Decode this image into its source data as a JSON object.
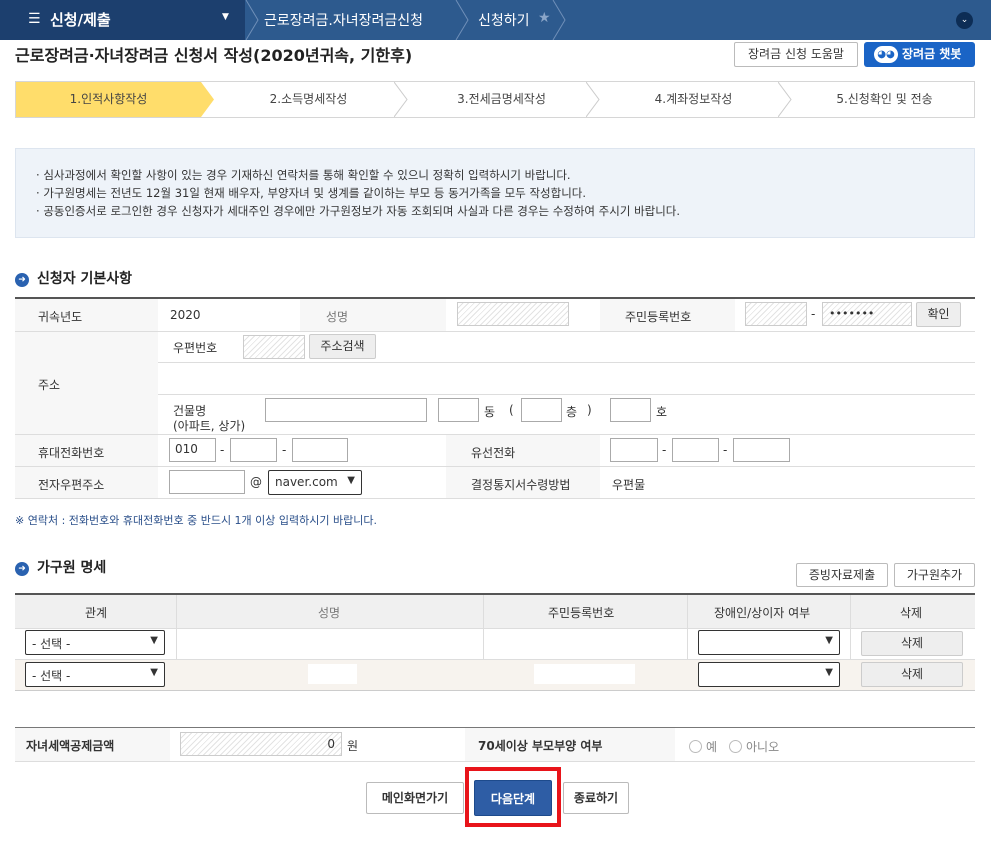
{
  "topbar": {
    "menu_label": "신청/제출",
    "crumbs": [
      "근로장려금.자녀장려금신청",
      "신청하기"
    ]
  },
  "page": {
    "title": "근로장려금·자녀장려금 신청서 작성(2020년귀속, 기한후)",
    "help_button": "장려금 신청 도움말",
    "chatbot_button": "장려금 챗봇"
  },
  "steps": [
    "1.인적사항작성",
    "2.소득명세작성",
    "3.전세금명세작성",
    "4.계좌정보작성",
    "5.신청확인 및 전송"
  ],
  "notice": [
    "심사과정에서 확인할 사항이 있는 경우 기재하신 연락처를 통해 확인할 수 있으니 정확히 입력하시기 바랍니다.",
    "가구원명세는 전년도 12월 31일 현재 배우자, 부양자녀 및 생계를 같이하는 부모 등 동거가족을 모두 작성합니다.",
    "공동인증서로 로그인한 경우 신청자가 세대주인 경우에만 가구원정보가 자동 조회되며 사실과 다른 경우는 수정하여 주시기 바랍니다."
  ],
  "applicant": {
    "section_title": "신청자 기본사항",
    "year_label": "귀속년도",
    "year_value": "2020",
    "name_label": "성명",
    "rrn_label": "주민등록번호",
    "rrn_dash": "-",
    "rrn_back": "•••••••",
    "confirm_button": "확인",
    "address_label": "주소",
    "zip_label": "우편번호",
    "address_search_button": "주소검색",
    "building_label": "건물명",
    "building_sub": "(아파트, 상가)",
    "dong": "동",
    "open_paren": "(",
    "floor": "층",
    "close_paren": ")",
    "ho": "호",
    "mobile_label": "휴대전화번호",
    "mobile_prefix": "010",
    "dash": "-",
    "landline_label": "유선전화",
    "email_label": "전자우편주소",
    "at": "@",
    "email_domain": "naver.com",
    "notice_method_label": "결정통지서수령방법",
    "notice_method_value": "우편물",
    "contact_note": "※ 연락처 : 전화번호와 휴대전화번호 중 반드시 1개 이상 입력하시기 바랍니다."
  },
  "household": {
    "section_title": "가구원 명세",
    "submit_docs_button": "증빙자료제출",
    "add_member_button": "가구원추가",
    "columns": [
      "관계",
      "성명",
      "주민등록번호",
      "장애인/상이자 여부",
      "삭제"
    ],
    "rows": [
      {
        "relation": "- 선택 -",
        "delete": "삭제"
      },
      {
        "relation": "- 선택 -",
        "delete": "삭제"
      }
    ]
  },
  "summary": {
    "child_credit_label": "자녀세액공제금액",
    "child_credit_value": "0",
    "won": "원",
    "parent70_label": "70세이상 부모부양 여부",
    "yes": "예",
    "no": "아니오"
  },
  "footer": {
    "main_button": "메인화면가기",
    "next_button": "다음단계",
    "exit_button": "종료하기"
  },
  "colors": {
    "topbar": "#2d5a8e",
    "active_step": "#ffdd6b",
    "next_button": "#2e5da5",
    "highlight": "#e8141a"
  }
}
